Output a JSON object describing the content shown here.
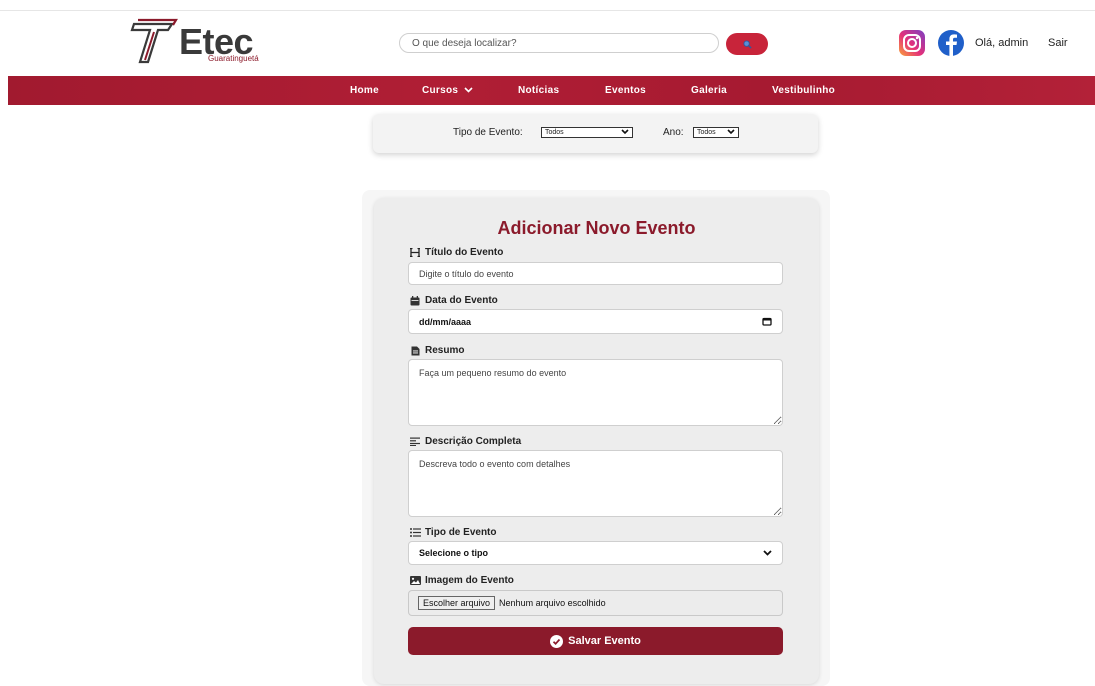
{
  "brand": {
    "name": "Etec",
    "subtitle": "Guaratinguetá",
    "accent": "#8b1a2b",
    "nav_color": "#a11a2f",
    "search_button_color": "#c8243a"
  },
  "search": {
    "placeholder": "O que deseja localizar?",
    "icon": "search-icon"
  },
  "social": {
    "instagram_icon": "instagram-icon",
    "facebook_icon": "facebook-icon"
  },
  "user": {
    "greeting": "Olá, admin",
    "logout": "Sair"
  },
  "nav": {
    "home": "Home",
    "cursos": "Cursos",
    "noticias": "Notícias",
    "eventos": "Eventos",
    "galeria": "Galeria",
    "vestibulinho": "Vestibulinho"
  },
  "filters": {
    "tipo_label": "Tipo de Evento:",
    "tipo_value": "Todos",
    "ano_label": "Ano:",
    "ano_value": "Todos"
  },
  "form": {
    "title": "Adicionar Novo Evento",
    "titulo": {
      "label": "Título do Evento",
      "placeholder": "Digite o título do evento",
      "icon": "heading-icon"
    },
    "data": {
      "label": "Data do Evento",
      "value": "dd/mm/aaaa",
      "icon": "calendar-icon"
    },
    "resumo": {
      "label": "Resumo",
      "placeholder": "Faça um pequeno resumo do evento",
      "icon": "file-icon"
    },
    "descricao": {
      "label": "Descrição Completa",
      "placeholder": "Descreva todo o evento com detalhes",
      "icon": "align-left-icon"
    },
    "tipo": {
      "label": "Tipo de Evento",
      "value": "Selecione o tipo",
      "icon": "list-icon"
    },
    "imagem": {
      "label": "Imagem do Evento",
      "button": "Escolher arquivo",
      "status": "Nenhum arquivo escolhido",
      "icon": "image-icon"
    },
    "save": "Salvar Evento"
  }
}
